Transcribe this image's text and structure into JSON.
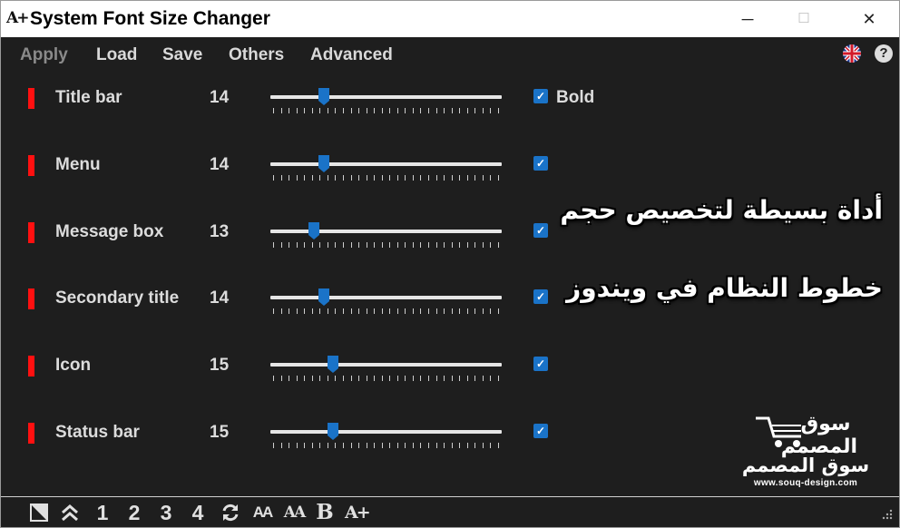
{
  "window": {
    "app_icon_text": "A+",
    "title": "System Font Size Changer",
    "minimize_glyph": "─",
    "maximize_glyph": "☐",
    "close_glyph": "✕"
  },
  "menu": {
    "items": [
      {
        "label": "Apply",
        "enabled": false
      },
      {
        "label": "Load",
        "enabled": true
      },
      {
        "label": "Save",
        "enabled": true
      },
      {
        "label": "Others",
        "enabled": true
      },
      {
        "label": "Advanced",
        "enabled": true
      }
    ],
    "language_icon": "uk-flag-icon",
    "help_glyph": "?"
  },
  "settings": {
    "rows": [
      {
        "label": "Title bar",
        "value": "14",
        "slider_fraction": 0.23,
        "checked": true,
        "check_label": "Bold"
      },
      {
        "label": "Menu",
        "value": "14",
        "slider_fraction": 0.23,
        "checked": true,
        "check_label": ""
      },
      {
        "label": "Message box",
        "value": "13",
        "slider_fraction": 0.19,
        "checked": true,
        "check_label": ""
      },
      {
        "label": "Secondary title",
        "value": "14",
        "slider_fraction": 0.23,
        "checked": true,
        "check_label": ""
      },
      {
        "label": "Icon",
        "value": "15",
        "slider_fraction": 0.27,
        "checked": true,
        "check_label": ""
      },
      {
        "label": "Status bar",
        "value": "15",
        "slider_fraction": 0.27,
        "checked": true,
        "check_label": ""
      }
    ],
    "marker_color": "#ff1010",
    "accent_color": "#1a73c8"
  },
  "overlay": {
    "line1": "أداة بسيطة لتخصيص حجم",
    "line2": "خطوط النظام في ويندوز"
  },
  "watermark": {
    "logo_text": "سوق المصمم",
    "arabic_name": "سوق المصمم",
    "url": "www.souq-design.com"
  },
  "toolbar": {
    "theme_icon": "contrast-icon",
    "collapse_icon": "double-chevron-up-icon",
    "presets": [
      "1",
      "2",
      "3",
      "4"
    ],
    "refresh_icon": "refresh-icon",
    "font_a_label": "AA",
    "font_b_label": "AA",
    "bold_label": "B",
    "font_plus_label": "A+"
  }
}
